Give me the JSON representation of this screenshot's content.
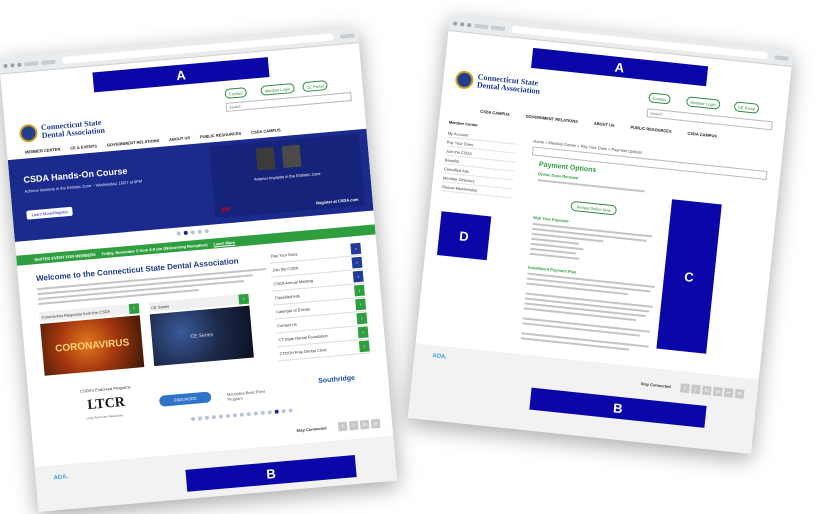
{
  "boxes": {
    "a": "A",
    "b": "B",
    "c": "C",
    "d": "D"
  },
  "left": {
    "site_title_line1": "Connecticut State",
    "site_title_line2": "Dental Association",
    "header_buttons": [
      "Contact",
      "Member Login",
      "CE Portal"
    ],
    "search_placeholder": "Search",
    "nav": [
      "MEMBER CENTER",
      "CE & EVENTS",
      "GOVERNMENT RELATIONS",
      "ABOUT US",
      "PUBLIC RESOURCES",
      "CSDA CAMPUS"
    ],
    "hero": {
      "title": "CSDA Hands-On Course",
      "subtitle": "Achieve Implants in the Esthetic Zone – Wednesday, 10/27 at 6PM",
      "button": "Learn More/Register",
      "panel_caption": "Anterior Implants in the Esthetic Zone",
      "panel_register": "Register at CSDA.com",
      "sponsor": "3M"
    },
    "green_bar": {
      "label": "INVITED EVENT FOR MEMBERS",
      "text": "Friday, November 5 from 6-9 pm (Welcoming Reception)",
      "link": "Learn More"
    },
    "welcome_title": "Welcome to the Connecticut State Dental Association",
    "cards": [
      {
        "label": "Coronavirus Response from the CSDA",
        "image_text": "CORONAVIRUS"
      },
      {
        "label": "CE Series",
        "image_text": "CE Series"
      }
    ],
    "side_list": [
      "Pay Your Dues",
      "Join the CSDA",
      "CSDA Annual Meeting",
      "Classified Ads",
      "Calendar of Events",
      "Contact Us",
      "CT State Dental Foundation",
      "CTDOH Free Dental Clinic"
    ],
    "partners_label": "CSDA's Endorsed Programs",
    "partner_ltcr": "LTCR",
    "partner_ltcr_sub": "Long Term Care Resources",
    "partner_pill": "ENDORSED",
    "partner_mercedes": "Mercedes-Benz Fleet Program",
    "partner_southridge": "Southridge",
    "stay_connected": "Stay Connected",
    "ada": "ADA."
  },
  "right": {
    "site_title_line1": "Connecticut State",
    "site_title_line2": "Dental Association",
    "header_buttons": [
      "Contact",
      "Member Login",
      "CE Portal"
    ],
    "search_placeholder": "Search",
    "nav": [
      "CSDA CAMPUS",
      "GOVERNMENT RELATIONS",
      "ABOUT US",
      "PUBLIC RESOURCES",
      "CSDA CAMPUS"
    ],
    "sidebar_head": "Member Center",
    "sidebar": [
      "My Account",
      "Pay Your Dues",
      "Join the CSDA",
      "Benefits",
      "Classified Ads",
      "Member Directory",
      "Renew Membership"
    ],
    "breadcrumb": "Home > Member Center > Pay Your Dues > Payment Options",
    "title": "Payment Options",
    "subtitle": "Online Dues Renewal",
    "button": "Renew Online Now",
    "mail_head": "Mail Your Payment",
    "installment_head": "Installment Payment Plan",
    "stay_connected": "Stay Connected",
    "ada": "ADA."
  }
}
